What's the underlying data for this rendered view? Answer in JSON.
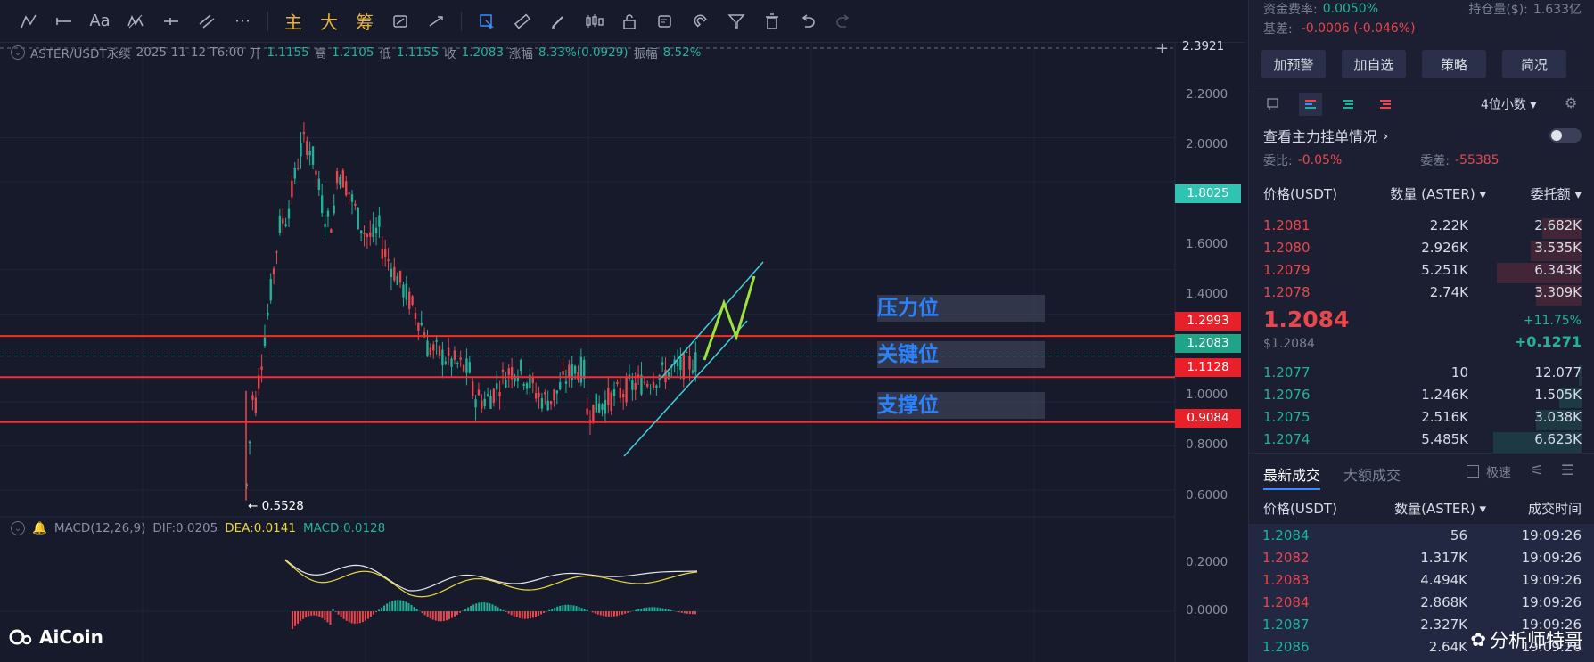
{
  "toolbar": {
    "text_tool": "Aa",
    "main_label": "主",
    "big_label": "大",
    "chip_label": "筹"
  },
  "kline": {
    "symbol": "ASTER/USDT永续",
    "time": "2025-11-12 T6:00",
    "open_label": "开",
    "open": "1.1155",
    "high_label": "高",
    "high": "1.2105",
    "low_label": "低",
    "low": "1.1155",
    "close_label": "收",
    "close": "1.2083",
    "change_label": "涨幅",
    "change": "8.33%(0.0929)",
    "amp_label": "振幅",
    "amp": "8.52%"
  },
  "price_axis": [
    "2.3921",
    "2.2000",
    "2.0000",
    "1.6000",
    "1.4000",
    "1.0000",
    "0.8000",
    "0.6000"
  ],
  "macd_axis": [
    "0.2000",
    "0.0000"
  ],
  "tags": {
    "top": "1.8025",
    "resistance": "1.2993",
    "current": "1.2083",
    "key": "1.1128",
    "support": "0.9084"
  },
  "zones": {
    "resistance": "压力位",
    "key": "关键位",
    "support": "支撑位"
  },
  "low_marker": "← 0.5528",
  "macd": {
    "name": "MACD(12,26,9)",
    "dif": "DIF:0.0205",
    "dea": "DEA:0.0141",
    "macd": "MACD:0.0128"
  },
  "logo": "AiCoin",
  "watermark": "分析师特哥",
  "panel": {
    "funding_label": "资金费率:",
    "funding": "0.0050%",
    "oi_label": "持仓量($):",
    "oi": "1.633亿",
    "basis_label": "基差:",
    "basis": "-0.0006 (-0.046%)",
    "buttons": [
      "加预警",
      "加自选",
      "策略",
      "简况"
    ],
    "decimals": "4位小数",
    "main_orders": "查看主力挂单情况",
    "ratio_label": "委比:",
    "ratio": "-0.05%",
    "diff_label": "委差:",
    "diff": "-55385",
    "col_price": "价格(USDT)",
    "col_qty": "数量 (ASTER)",
    "col_amount": "委托额",
    "asks": [
      {
        "price": "1.2081",
        "qty": "2.22K",
        "amount": "2.682K",
        "depth": 0.35
      },
      {
        "price": "1.2080",
        "qty": "2.926K",
        "amount": "3.535K",
        "depth": 0.45
      },
      {
        "price": "1.2079",
        "qty": "5.251K",
        "amount": "6.343K",
        "depth": 0.75
      },
      {
        "price": "1.2078",
        "qty": "2.74K",
        "amount": "3.309K",
        "depth": 0.4
      }
    ],
    "last_price": "1.2084",
    "last_usd": "$1.2084",
    "pct": "+11.75%",
    "abs": "+0.1271",
    "bids": [
      {
        "price": "1.2077",
        "qty": "10",
        "amount": "12.077",
        "depth": 0.02
      },
      {
        "price": "1.2076",
        "qty": "1.246K",
        "amount": "1.505K",
        "depth": 0.2
      },
      {
        "price": "1.2075",
        "qty": "2.516K",
        "amount": "3.038K",
        "depth": 0.4
      },
      {
        "price": "1.2074",
        "qty": "5.485K",
        "amount": "6.623K",
        "depth": 0.78
      }
    ],
    "trades_tab": "最新成交",
    "big_trades_tab": "大额成交",
    "fast_label": "极速",
    "t_col_price": "价格(USDT)",
    "t_col_qty": "数量(ASTER)",
    "t_col_time": "成交时间",
    "trades": [
      {
        "price": "1.2084",
        "qty": "56",
        "time": "19:09:26",
        "side": "buy"
      },
      {
        "price": "1.2082",
        "qty": "1.317K",
        "time": "19:09:26",
        "side": "sell"
      },
      {
        "price": "1.2083",
        "qty": "4.494K",
        "time": "19:09:26",
        "side": "sell"
      },
      {
        "price": "1.2084",
        "qty": "2.868K",
        "time": "19:09:26",
        "side": "sell"
      },
      {
        "price": "1.2087",
        "qty": "2.327K",
        "time": "19:09:26",
        "side": "buy"
      },
      {
        "price": "1.2086",
        "qty": "2.64K",
        "time": "19:09:26",
        "side": "buy"
      }
    ]
  },
  "colors": {
    "up": "#20b39a",
    "down": "#e8474d",
    "level_line": "#ff2a2a",
    "zone_text": "#2b82ff",
    "channel": "#3fd0d8",
    "projection": "#9fe33a"
  }
}
